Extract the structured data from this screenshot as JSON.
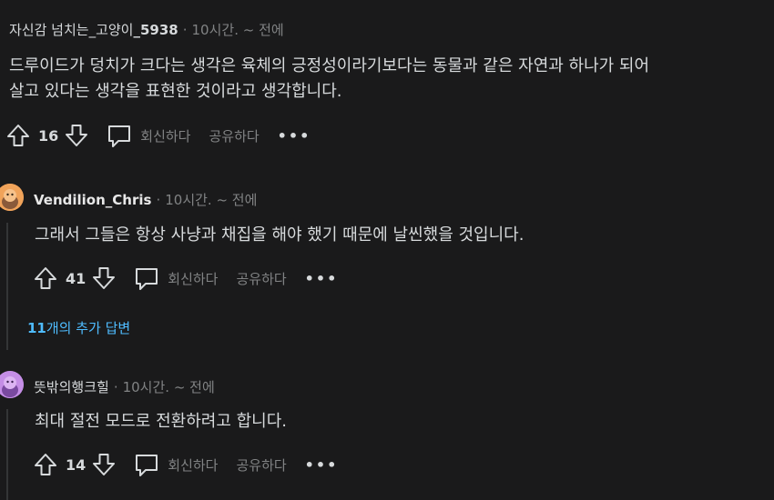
{
  "comments": [
    {
      "author": "자신감 넘치는_고양이",
      "author_suffix": "_5938",
      "time": "10시간. ~ 전에",
      "body_lines": [
        "드루이드가 덩치가 크다는 생각은 육체의 긍정성이라기보다는 동물과 같은 자연과 하나가 되어",
        "살고 있다는 생각을 표현한 것이라고 생각합니다."
      ],
      "score": "16"
    },
    {
      "author": "Vendilion_Chris",
      "time": "10시간. ~ 전에",
      "body_lines": [
        "그래서 그들은 항상 사냥과 채집을 해야 했기 때문에 날씬했을 것입니다."
      ],
      "score": "41",
      "more_replies": {
        "count": "11",
        "label": "개의 추가 답변"
      }
    },
    {
      "author": "뜻밖의행크힐",
      "time": "10시간. ~ 전에",
      "body_lines": [
        "최대 절전 모드로 전환하려고 합니다."
      ],
      "score": "14"
    }
  ],
  "actions": {
    "reply": "회신하다",
    "share": "공유하다",
    "more": "•••"
  },
  "icons": [
    "upvote-icon",
    "downvote-icon",
    "comment-icon",
    "avatar-icon"
  ],
  "colors": {
    "background": "#1a1a1b",
    "text": "#d7dadc",
    "meta": "#818384",
    "link": "#4fbcff",
    "avatar1": "#f0a35a",
    "avatar2": "#c58ee6"
  }
}
